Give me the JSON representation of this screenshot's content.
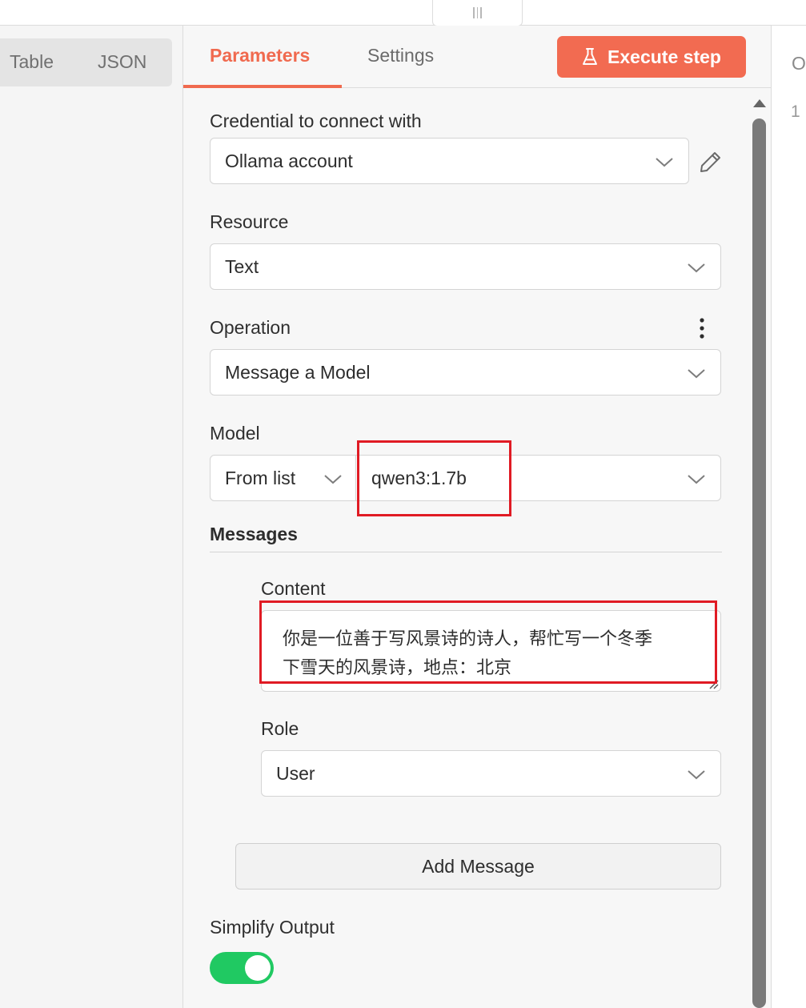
{
  "left": {
    "view_options": [
      "Table",
      "JSON"
    ]
  },
  "tabs": {
    "parameters": "Parameters",
    "settings": "Settings"
  },
  "execute_label": "Execute step",
  "credential": {
    "label": "Credential to connect with",
    "value": "Ollama account"
  },
  "resource": {
    "label": "Resource",
    "value": "Text"
  },
  "operation": {
    "label": "Operation",
    "value": "Message a Model"
  },
  "model": {
    "label": "Model",
    "mode": "From list",
    "value": "qwen3:1.7b"
  },
  "messages": {
    "title": "Messages",
    "content_label": "Content",
    "content_line1": "你是一位善于写风景诗的诗人，帮忙写一个冬季",
    "content_line2": "下雪天的风景诗，地点：北京",
    "role_label": "Role",
    "role_value": "User",
    "add_label": "Add Message"
  },
  "simplify": {
    "label": "Simplify Output",
    "enabled": true
  },
  "right": {
    "header_char": "O",
    "line_number": "1"
  },
  "colors": {
    "accent": "#f26b51",
    "toggle_on": "#20c962",
    "highlight": "#e01b24"
  }
}
